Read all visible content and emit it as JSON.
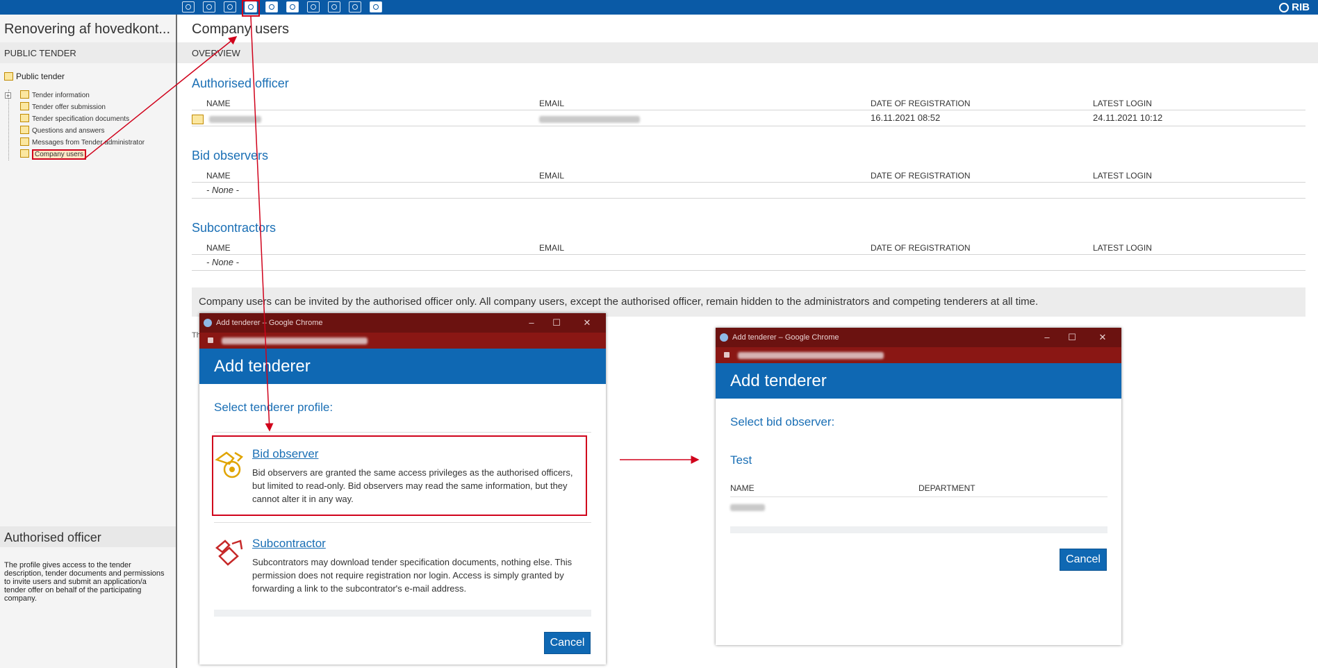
{
  "app": {
    "brand": "RIB"
  },
  "toolbar": {
    "icons": [
      "tender-icon",
      "download-icon",
      "upload-icon",
      "company-users-icon",
      "add-user-icon",
      "users-icon",
      "mail-icon",
      "documents-icon",
      "questions-icon",
      "messages-icon"
    ]
  },
  "sidebar": {
    "project_title": "Renovering af hovedkont...",
    "section_label": "PUBLIC TENDER",
    "tree_root": "Public tender",
    "items": [
      {
        "label": "Tender information",
        "expandable": true
      },
      {
        "label": "Tender offer submission"
      },
      {
        "label": "Tender specification documents"
      },
      {
        "label": "Questions and answers"
      },
      {
        "label": "Messages from Tender administrator"
      },
      {
        "label": "Company users",
        "selected": true
      }
    ],
    "info_title": "Authorised officer",
    "info_text": "The profile gives access to the tender description, tender documents and permissions to invite users and submit an application/a tender offer on behalf of the participating company."
  },
  "main": {
    "title": "Company users",
    "overview_label": "OVERVIEW",
    "columns": {
      "name": "NAME",
      "email": "EMAIL",
      "date": "DATE OF REGISTRATION",
      "login": "LATEST LOGIN"
    },
    "authorised": {
      "heading": "Authorised officer",
      "rows": [
        {
          "date": "16.11.2021 08:52",
          "login": "24.11.2021 10:12"
        }
      ]
    },
    "bid_observers": {
      "heading": "Bid observers",
      "none": "- None -"
    },
    "subcontractors": {
      "heading": "Subcontractors",
      "none": "- None -"
    },
    "notice": "Company users can be invited by the authorised officer only. All company users, except the authorised officer, remain hidden to the administrators and competing tenderers at all time.",
    "fragment": "Th"
  },
  "popup1": {
    "window_title": "Add tenderer – Google Chrome",
    "header": "Add tenderer",
    "subtitle": "Select tenderer profile:",
    "options": [
      {
        "title": "Bid observer",
        "desc": "Bid observers are granted the same access privileges as the authorised officers, but limited to read-only. Bid observers may read the same information, but they cannot alter it in any way."
      },
      {
        "title": "Subcontractor",
        "desc": "Subcontrators may download tender specification documents, nothing else. This permission does not require registration nor login. Access is simply granted by forwarding a link to the subcontrator's e-mail address."
      }
    ],
    "cancel": "Cancel"
  },
  "popup2": {
    "window_title": "Add tenderer – Google Chrome",
    "header": "Add tenderer",
    "subtitle": "Select bid observer:",
    "group": "Test",
    "col_name": "NAME",
    "col_department": "DEPARTMENT",
    "cancel": "Cancel"
  },
  "window_controls": {
    "minimize": "–",
    "maximize": "☐",
    "close": "✕"
  },
  "colors": {
    "toolbar": "#0a5aa6",
    "accent": "#1a6fb5",
    "chrome": "#6b1210",
    "highlight": "#d0021b"
  }
}
